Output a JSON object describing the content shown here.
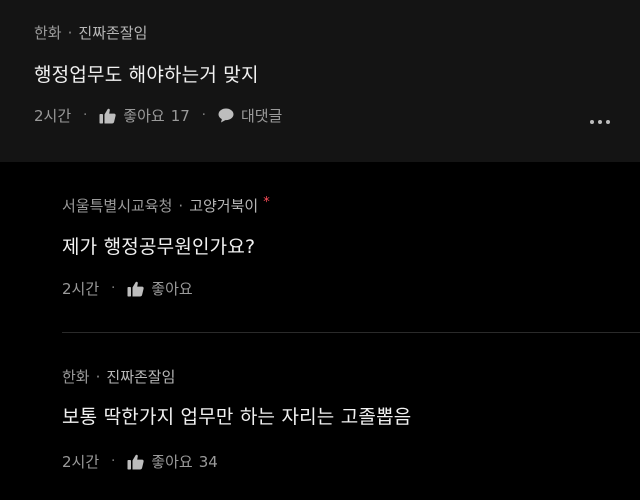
{
  "comments": [
    {
      "company": "한화",
      "nickname": "진짜존잘임",
      "text": "행정업무도 해야하는거 맞지",
      "time": "2시간",
      "like_label": "좋아요",
      "like_count": "17",
      "reply_label": "대댓글"
    },
    {
      "company": "서울특별시교육청",
      "nickname": "고양거북이",
      "author_mark": "*",
      "text": "제가 행정공무원인가요?",
      "time": "2시간",
      "like_label": "좋아요"
    },
    {
      "company": "한화",
      "nickname": "진짜존잘임",
      "text": "보통 딱한가지 업무만 하는 자리는 고졸뽑음",
      "time": "2시간",
      "like_label": "좋아요",
      "like_count": "34"
    }
  ],
  "separator": "·",
  "colors": {
    "main_bg": "#141414",
    "reply_bg": "#000000",
    "author_mark": "#ff4d5a"
  }
}
